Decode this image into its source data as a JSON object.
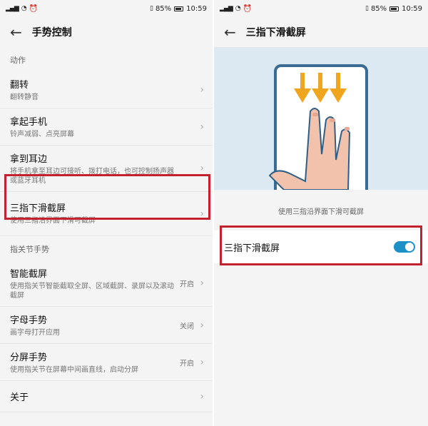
{
  "status": {
    "time": "10:59",
    "battery": "85%"
  },
  "left": {
    "title": "手势控制",
    "section1": "动作",
    "items": [
      {
        "title": "翻转",
        "subtitle": "翻转静音"
      },
      {
        "title": "拿起手机",
        "subtitle": "铃声减弱、点亮屏幕"
      },
      {
        "title": "拿到耳边",
        "subtitle": "将手机拿至耳边可接听、拨打电话，也可控制扬声器或蓝牙耳机"
      },
      {
        "title": "三指下滑截屏",
        "subtitle": "使用三指沿界面下滑可截屏"
      }
    ],
    "section2": "指关节手势",
    "items2": [
      {
        "title": "智能截屏",
        "subtitle": "使用指关节智能截取全屏、区域截屏、录屏以及滚动截屏",
        "value": "开启"
      },
      {
        "title": "字母手势",
        "subtitle": "画字母打开应用",
        "value": "关闭"
      },
      {
        "title": "分屏手势",
        "subtitle": "使用指关节在屏幕中间画直线，启动分屏",
        "value": "开启"
      },
      {
        "title": "关于",
        "subtitle": "",
        "value": ""
      }
    ]
  },
  "right": {
    "title": "三指下滑截屏",
    "caption": "使用三指沿界面下滑可截屏",
    "toggle_label": "三指下滑截屏",
    "toggle_on": true
  },
  "colors": {
    "highlight": "#c4212f",
    "accent": "#1e90c8",
    "arrow": "#f0a51f"
  }
}
